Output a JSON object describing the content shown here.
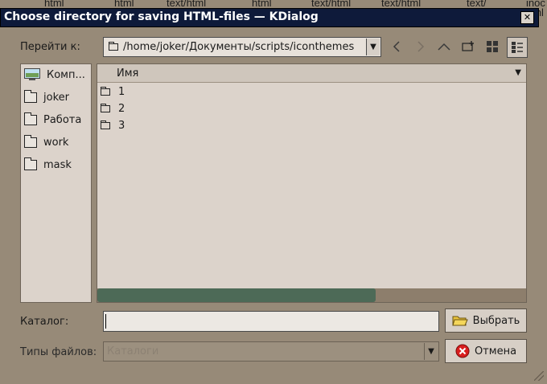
{
  "background_labels": [
    "html",
    "html",
    "text/html",
    "html",
    "text/html",
    "text/html",
    "text/",
    "inoc",
    "nml"
  ],
  "window": {
    "title": "Choose directory for saving HTML-files — KDialog",
    "close_glyph": "✕"
  },
  "toolbar": {
    "goto_label": "Перейти к:",
    "path": "/home/joker/Документы/scripts/iconthemes"
  },
  "places": [
    {
      "label": "Комп...",
      "icon": "computer-icon"
    },
    {
      "label": "joker",
      "icon": "folder-icon"
    },
    {
      "label": "Работа",
      "icon": "folder-icon"
    },
    {
      "label": "work",
      "icon": "folder-icon"
    },
    {
      "label": "mask",
      "icon": "folder-icon"
    }
  ],
  "file_list": {
    "column_header": "Имя",
    "items": [
      "1",
      "2",
      "3"
    ],
    "scroll_fraction": 0.65
  },
  "footer": {
    "catalog_label": "Каталог:",
    "catalog_value": "",
    "filetypes_label": "Типы файлов:",
    "filetypes_value": "Каталоги",
    "select_button": "Выбрать",
    "cancel_button": "Отмена"
  },
  "colors": {
    "titlebar": "#0e1a3a",
    "window_bg": "#978a78",
    "scroll_thumb": "#4d6a57"
  }
}
